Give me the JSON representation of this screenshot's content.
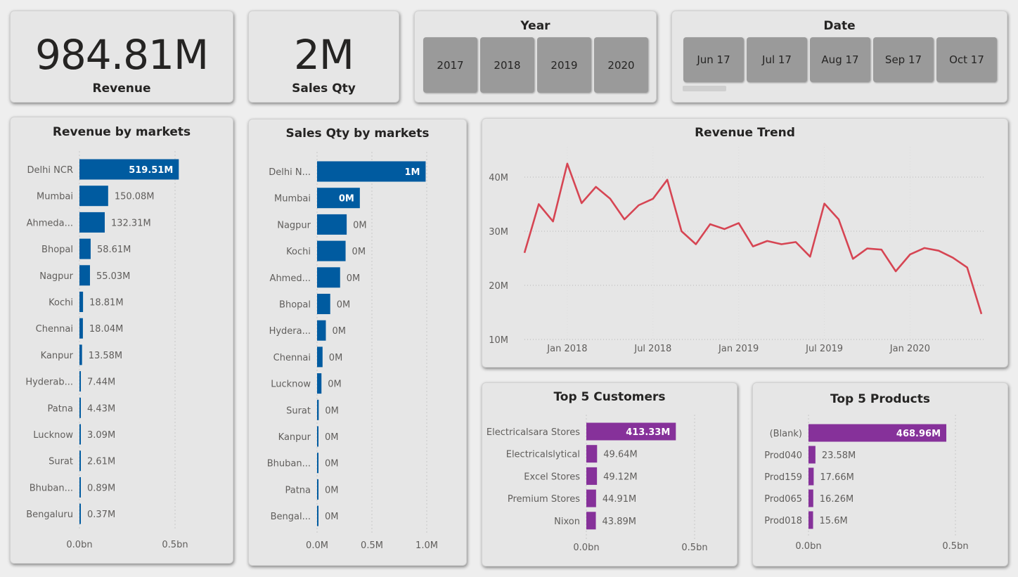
{
  "kpis": {
    "revenue": {
      "value": "984.81M",
      "label": "Revenue"
    },
    "sales_qty": {
      "value": "2M",
      "label": "Sales Qty"
    }
  },
  "slicers": {
    "year": {
      "title": "Year",
      "options": [
        "2017",
        "2018",
        "2019",
        "2020"
      ]
    },
    "date": {
      "title": "Date",
      "options": [
        "Jun 17",
        "Jul 17",
        "Aug 17",
        "Sep 17",
        "Oct 17"
      ]
    }
  },
  "colors": {
    "bar_blue": "#005ba0",
    "bar_purple": "#86319a",
    "line_red": "#d64553"
  },
  "chart_data": [
    {
      "id": "revenue-by-markets",
      "type": "bar",
      "orientation": "horizontal",
      "title": "Revenue by markets",
      "categories": [
        "Delhi NCR",
        "Mumbai",
        "Ahmeda...",
        "Bhopal",
        "Nagpur",
        "Kochi",
        "Chennai",
        "Kanpur",
        "Hyderab...",
        "Patna",
        "Lucknow",
        "Surat",
        "Bhuban...",
        "Bengaluru"
      ],
      "values": [
        519.51,
        150.08,
        132.31,
        58.61,
        55.03,
        18.81,
        18.04,
        13.58,
        7.44,
        4.43,
        3.09,
        2.61,
        0.89,
        0.37
      ],
      "value_labels": [
        "519.51M",
        "150.08M",
        "132.31M",
        "58.61M",
        "55.03M",
        "18.81M",
        "18.04M",
        "13.58M",
        "7.44M",
        "4.43M",
        "3.09M",
        "2.61M",
        "0.89M",
        "0.37M"
      ],
      "xlim": [
        0,
        500
      ],
      "xticks": [
        "0.0bn",
        "0.5bn"
      ],
      "grid": true
    },
    {
      "id": "sales-qty-by-markets",
      "type": "bar",
      "orientation": "horizontal",
      "title": "Sales Qty by markets",
      "categories": [
        "Delhi N...",
        "Mumbai",
        "Nagpur",
        "Kochi",
        "Ahmed...",
        "Bhopal",
        "Hydera...",
        "Chennai",
        "Lucknow",
        "Surat",
        "Kanpur",
        "Bhuban...",
        "Patna",
        "Bengal..."
      ],
      "values": [
        0.99,
        0.39,
        0.27,
        0.26,
        0.21,
        0.12,
        0.08,
        0.05,
        0.04,
        0.015,
        0.012,
        0.01,
        0.008,
        0.006
      ],
      "value_labels": [
        "1M",
        "0M",
        "0M",
        "0M",
        "0M",
        "0M",
        "0M",
        "0M",
        "0M",
        "0M",
        "0M",
        "0M",
        "0M",
        "0M"
      ],
      "xlim": [
        0,
        1.0
      ],
      "xticks": [
        "0.0M",
        "0.5M",
        "1.0M"
      ],
      "grid": true
    },
    {
      "id": "revenue-trend",
      "type": "line",
      "title": "Revenue Trend",
      "x": [
        "2017-10",
        "2017-11",
        "2017-12",
        "2018-01",
        "2018-02",
        "2018-03",
        "2018-04",
        "2018-05",
        "2018-06",
        "2018-07",
        "2018-08",
        "2018-09",
        "2018-10",
        "2018-11",
        "2018-12",
        "2019-01",
        "2019-02",
        "2019-03",
        "2019-04",
        "2019-05",
        "2019-06",
        "2019-07",
        "2019-08",
        "2019-09",
        "2019-10",
        "2019-11",
        "2019-12",
        "2020-01",
        "2020-02",
        "2020-03",
        "2020-04",
        "2020-05"
      ],
      "values": [
        26.0,
        35.0,
        31.8,
        42.5,
        35.2,
        38.2,
        36.0,
        32.2,
        34.8,
        36.0,
        39.5,
        30.0,
        27.6,
        31.3,
        30.4,
        31.5,
        27.2,
        28.2,
        27.6,
        28.0,
        25.3,
        35.1,
        32.2,
        24.9,
        26.8,
        26.6,
        22.6,
        25.7,
        26.9,
        26.4,
        25.1,
        23.3,
        14.7
      ],
      "xticks": [
        "Jan 2018",
        "Jul 2018",
        "Jan 2019",
        "Jul 2019",
        "Jan 2020"
      ],
      "yticks": [
        "10M",
        "20M",
        "30M",
        "40M"
      ],
      "ylim": [
        10,
        45
      ],
      "grid": true
    },
    {
      "id": "top-5-customers",
      "type": "bar",
      "orientation": "horizontal",
      "title": "Top 5 Customers",
      "categories": [
        "Electricalsara Stores",
        "Electricalslytical",
        "Excel Stores",
        "Premium Stores",
        "Nixon"
      ],
      "values": [
        413.33,
        49.64,
        49.12,
        44.91,
        43.89
      ],
      "value_labels": [
        "413.33M",
        "49.64M",
        "49.12M",
        "44.91M",
        "43.89M"
      ],
      "xlim": [
        0,
        500
      ],
      "xticks": [
        "0.0bn",
        "0.5bn"
      ],
      "grid": true
    },
    {
      "id": "top-5-products",
      "type": "bar",
      "orientation": "horizontal",
      "title": "Top 5 Products",
      "categories": [
        "(Blank)",
        "Prod040",
        "Prod159",
        "Prod065",
        "Prod018"
      ],
      "values": [
        468.96,
        23.58,
        17.66,
        16.26,
        15.6
      ],
      "value_labels": [
        "468.96M",
        "23.58M",
        "17.66M",
        "16.26M",
        "15.6M"
      ],
      "xlim": [
        0,
        500
      ],
      "xticks": [
        "0.0bn",
        "0.5bn"
      ],
      "grid": true
    }
  ]
}
